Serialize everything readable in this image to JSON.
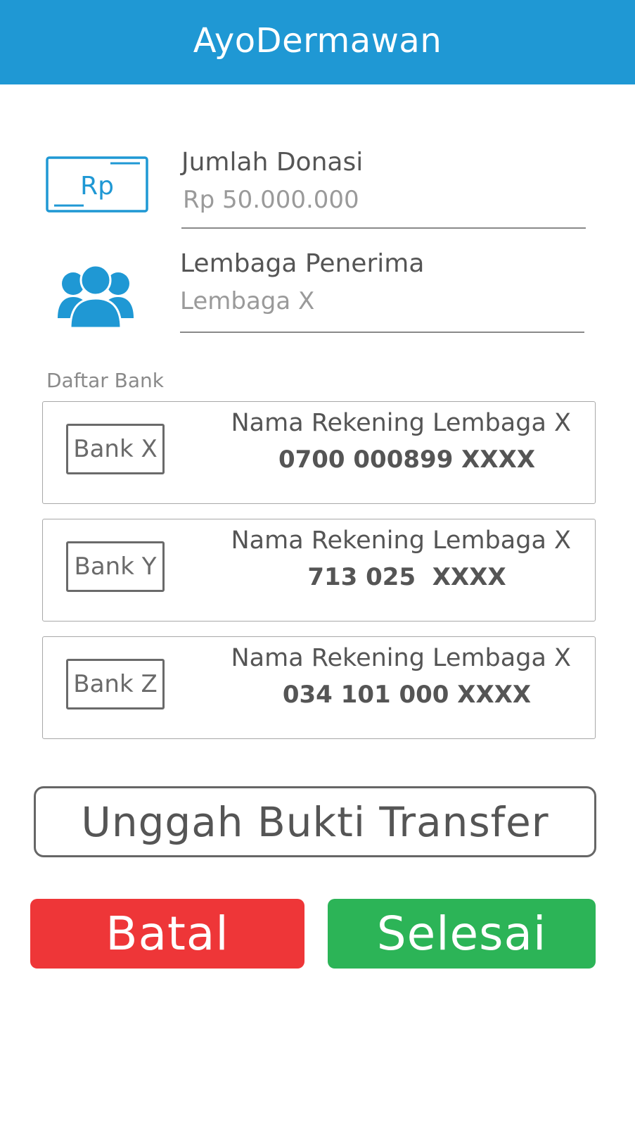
{
  "header": {
    "title": "AyoDermawan",
    "color": "#1f98d4"
  },
  "donation": {
    "icon": "money-bill-rp-icon",
    "icon_text": "Rp",
    "label": "Jumlah Donasi",
    "value": "Rp 50.000.000"
  },
  "recipient": {
    "icon": "group-users-icon",
    "label": "Lembaga Penerima",
    "value": "Lembaga X"
  },
  "banks": {
    "section_label": "Daftar Bank",
    "items": [
      {
        "bank": "Bank X",
        "account_name": "Nama Rekening Lembaga X",
        "account_number": "0700 000899 XXXX"
      },
      {
        "bank": "Bank Y",
        "account_name": "Nama Rekening Lembaga X",
        "account_number": "713 025  XXXX"
      },
      {
        "bank": "Bank Z",
        "account_name": "Nama Rekening Lembaga X",
        "account_number": "034 101 000 XXXX"
      }
    ]
  },
  "actions": {
    "upload_label": "Unggah Bukti Transfer",
    "cancel_label": "Batal",
    "done_label": "Selesai",
    "cancel_color": "#ee3638",
    "done_color": "#2cb457"
  }
}
